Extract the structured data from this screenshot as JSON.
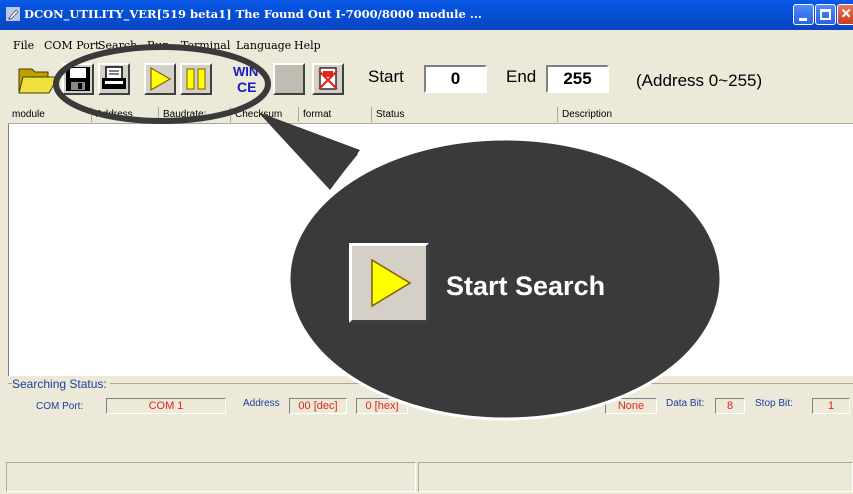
{
  "window": {
    "title": "DCON_UTILITY_VER[519  beta1] The Found Out I-7000/8000 module ...",
    "app_icon": "pencil-app-icon",
    "controls": [
      "minimize-icon",
      "maximize-icon",
      "close-icon"
    ]
  },
  "menu": {
    "items": [
      "File",
      "COM Port",
      "Search",
      "Run",
      "Terminal",
      "Language",
      "Help"
    ]
  },
  "toolbar": {
    "buttons": [
      {
        "name": "open-folder-icon"
      },
      {
        "name": "save-disk-icon"
      },
      {
        "name": "printer-icon"
      },
      {
        "name": "start-play-icon"
      },
      {
        "name": "pause-icon"
      },
      {
        "name": "wince-icon",
        "text_top": "WIN",
        "text_bottom": "CE"
      },
      {
        "name": "blank-button"
      },
      {
        "name": "clear-icon"
      }
    ],
    "start_label": "Start",
    "start_value": "0",
    "end_label": "End",
    "end_value": "255",
    "range_note": "(Address 0~255)"
  },
  "columns": [
    "module",
    "Address",
    "Baudrate:",
    "Checksum",
    "format",
    "Status",
    "Description"
  ],
  "searching_status": {
    "legend": "Searching Status:",
    "com_port_label": "COM Port:",
    "com_port_value": "COM 1",
    "address_label": "Address",
    "address_dec": "00 [dec]",
    "address_hex": "0 [hex]",
    "parity_value": "None",
    "data_bit_label": "Data Bit:",
    "data_bit_value": "8",
    "stop_bit_label": "Stop Bit:",
    "stop_bit_value": "1"
  },
  "callout": {
    "text": "Start Search",
    "icon": "start-play-icon"
  },
  "colors": {
    "title_bar": "#0a4fd6",
    "callout_fill": "#2e2e2e",
    "status_label": "#1b3d9d",
    "status_value": "#e0261d",
    "play_yellow": "#ffff00"
  }
}
